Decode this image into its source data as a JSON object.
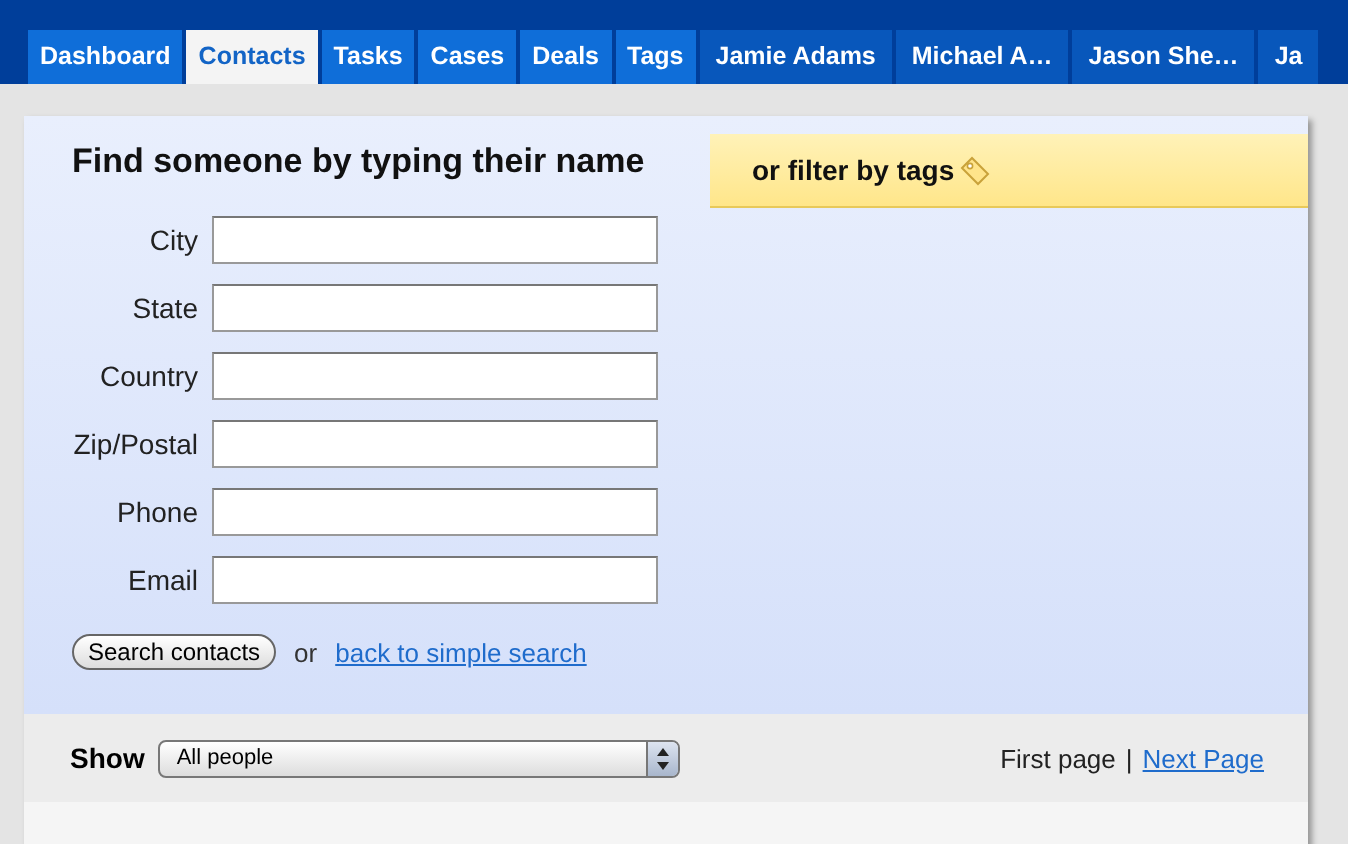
{
  "tabs": [
    {
      "label": "Dashboard",
      "kind": "section",
      "selected": false
    },
    {
      "label": "Contacts",
      "kind": "section",
      "selected": true
    },
    {
      "label": "Tasks",
      "kind": "section",
      "selected": false
    },
    {
      "label": "Cases",
      "kind": "section",
      "selected": false
    },
    {
      "label": "Deals",
      "kind": "section",
      "selected": false
    },
    {
      "label": "Tags",
      "kind": "section",
      "selected": false
    },
    {
      "label": "Jamie Adams",
      "kind": "person",
      "selected": false
    },
    {
      "label": "Michael A…",
      "kind": "person",
      "selected": false
    },
    {
      "label": "Jason She…",
      "kind": "person",
      "selected": false
    },
    {
      "label": "Ja",
      "kind": "person",
      "selected": false
    }
  ],
  "search": {
    "title": "Find someone by typing their name",
    "fields": [
      {
        "label": "City"
      },
      {
        "label": "State"
      },
      {
        "label": "Country"
      },
      {
        "label": "Zip/Postal"
      },
      {
        "label": "Phone"
      },
      {
        "label": "Email"
      }
    ],
    "button": "Search contacts",
    "or": "or",
    "link": "back to simple search"
  },
  "tags_panel": {
    "title": "or filter by tags"
  },
  "list_bar": {
    "show_label": "Show",
    "select_value": "All people",
    "first_page": "First page",
    "separator": "|",
    "next_page": "Next Page"
  }
}
